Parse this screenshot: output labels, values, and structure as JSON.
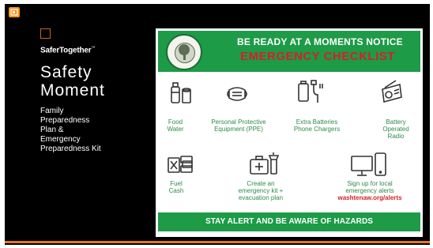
{
  "app": {
    "icon": "presentation-app-icon"
  },
  "slide": {
    "brand": "SaferTogether",
    "brand_mark": "™",
    "title_line1": "Safety",
    "title_line2": "Moment",
    "subtitle_lines": [
      "Family",
      "Preparedness",
      "Plan &",
      "Emergency",
      "Preparedness Kit"
    ]
  },
  "poster": {
    "header_top": "BE READY AT A MOMENTS NOTICE",
    "header_main": "EMERGENCY CHECKLIST",
    "items": [
      {
        "icon": "food-water-icon",
        "lines": [
          "Food",
          "Water"
        ]
      },
      {
        "icon": "ppe-mask-icon",
        "lines": [
          "Personal Protective",
          "Equipment (PPE)"
        ]
      },
      {
        "icon": "battery-charger-icon",
        "lines": [
          "Extra Batteries",
          "Phone Chargers"
        ]
      },
      {
        "icon": "radio-icon",
        "lines": [
          "Battery",
          "Operated",
          "Radio"
        ]
      },
      {
        "icon": "fuel-cash-icon",
        "lines": [
          "Fuel",
          "Cash"
        ]
      },
      {
        "icon": "emergency-kit-icon",
        "lines": [
          "Create an",
          "emergency kit +",
          "evacuation plan"
        ]
      },
      {
        "icon": "devices-alert-icon",
        "lines": [
          "Sign up for local",
          "emergency alerts"
        ]
      }
    ],
    "alerts_url": "washtenaw.org/alerts",
    "footer": "STAY ALERT AND BE AWARE OF HAZARDS"
  },
  "colors": {
    "green": "#1d9b47",
    "red": "#d4202c",
    "orange": "#e3781f"
  }
}
